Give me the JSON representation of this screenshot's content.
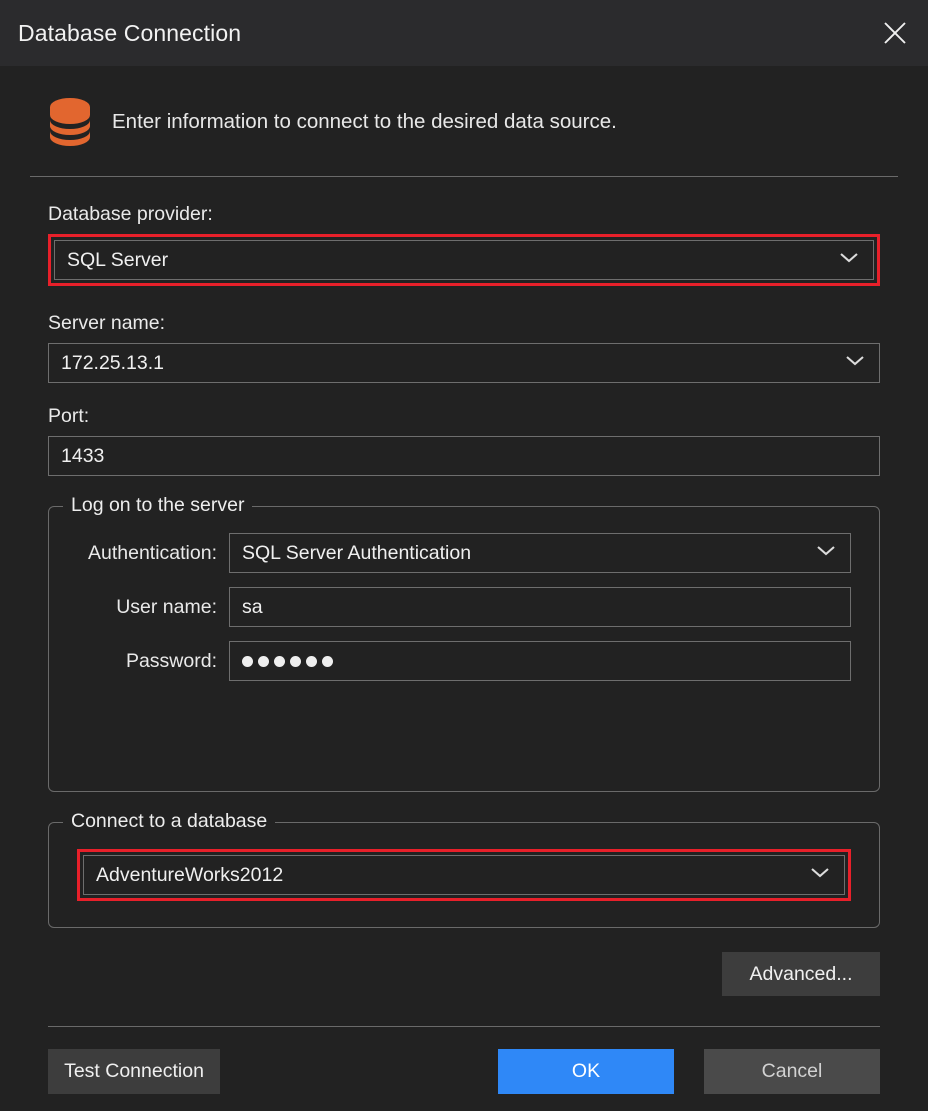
{
  "window": {
    "title": "Database Connection",
    "close_icon": "close-icon"
  },
  "header": {
    "icon": "database-icon",
    "caption": "Enter information to connect to the desired data source."
  },
  "fields": {
    "provider_label": "Database provider:",
    "provider_value": "SQL Server",
    "server_label": "Server name:",
    "server_value": "172.25.13.1",
    "port_label": "Port:",
    "port_value": "1433"
  },
  "logon_group": {
    "legend": "Log on to the server",
    "authentication_label": "Authentication:",
    "authentication_value": "SQL Server Authentication",
    "username_label": "User name:",
    "username_value": "sa",
    "password_label": "Password:",
    "password_mask_count": 6
  },
  "database_group": {
    "legend": "Connect to a database",
    "database_value": "AdventureWorks2012"
  },
  "buttons": {
    "advanced": "Advanced...",
    "test_connection": "Test Connection",
    "ok": "OK",
    "cancel": "Cancel"
  },
  "colors": {
    "window_background": "#222222",
    "titlebar_background": "#2b2b2d",
    "accent_primary": "#2f88f7",
    "highlight_red": "#e8202a",
    "database_icon_orange": "#e2662f",
    "border_gray": "#6e6e6e",
    "button_gray": "#3d3d3d",
    "cancel_gray": "#4a4a4a"
  },
  "icons": {
    "chevron_down": "chevron-down-icon"
  }
}
